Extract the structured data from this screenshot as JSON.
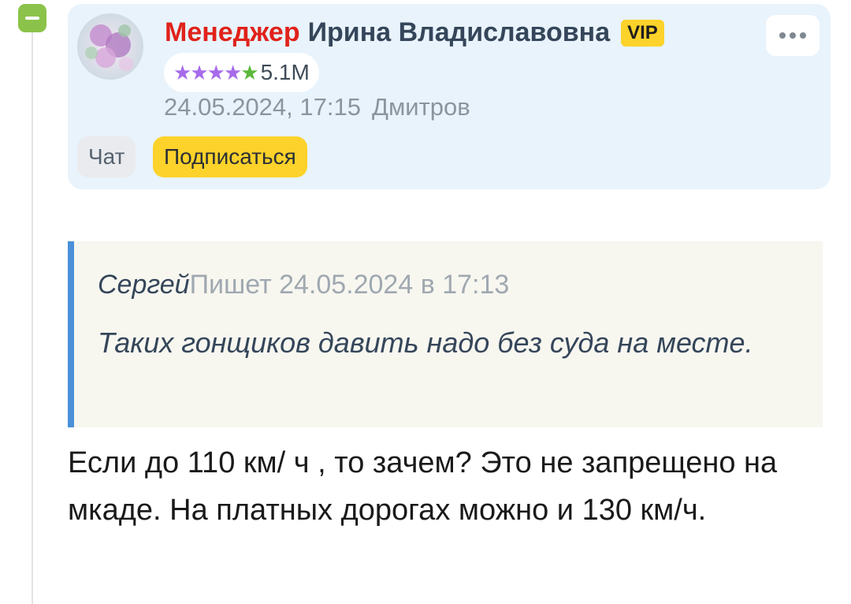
{
  "comment": {
    "author": {
      "role": "Менеджер",
      "name": "Ирина Владиславовна",
      "badge": "VIP",
      "rating": "5.1M",
      "stars": 5
    },
    "date": "24.05.2024, 17:15",
    "city": "Дмитров",
    "actions": {
      "chat_label": "Чат",
      "subscribe_label": "Подписаться"
    },
    "quote": {
      "author": "Сергей",
      "meta": "Пишет 24.05.2024 в 17:13",
      "text": "Таких гонщиков давить надо без суда на месте."
    },
    "body": "Если до 110 км/ ч , то зачем? Это не запрещено на мкаде. На платных дорогах можно и 130 км/ч."
  },
  "icons": {
    "collapse": "minus-icon",
    "more": "more-icon",
    "stars": "star-icon"
  },
  "colors": {
    "role": "#e0221a",
    "vip": "#fdd22a",
    "subscribe": "#fdd22a",
    "card_bg": "#e8f3fc",
    "quote_border": "#4a90d9",
    "collapse": "#8bc34a",
    "star_purple": "#a66bea",
    "star_green": "#5cb83a"
  }
}
